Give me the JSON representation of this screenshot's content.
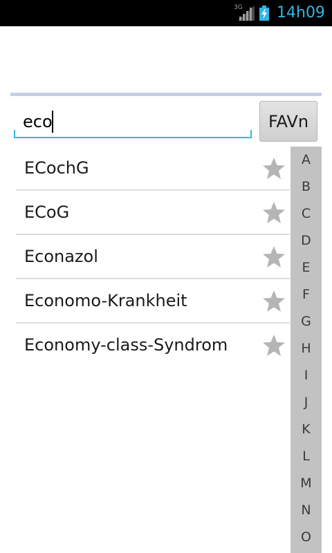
{
  "status_bar": {
    "network_type": "3G",
    "time": "14h09",
    "signal_icon": "signal-icon",
    "battery_icon": "battery-charging-icon",
    "time_color": "#33b5e5"
  },
  "search": {
    "value": "eco",
    "placeholder": ""
  },
  "fav_button": {
    "label": "FAVn"
  },
  "results": [
    {
      "label": "ECochG",
      "icon": "star-icon"
    },
    {
      "label": "ECoG",
      "icon": "star-icon"
    },
    {
      "label": "Econazol",
      "icon": "star-icon"
    },
    {
      "label": "Economo-Krankheit",
      "icon": "star-icon"
    },
    {
      "label": "Economy-class-Syndrom",
      "icon": "star-icon"
    }
  ],
  "alphabet_index": [
    "A",
    "B",
    "C",
    "D",
    "E",
    "F",
    "G",
    "H",
    "I",
    "J",
    "K",
    "L",
    "M",
    "N",
    "O"
  ],
  "colors": {
    "accent": "#33b5e5",
    "divider": "#c5cfe8",
    "index_background": "#c2c2c2",
    "star": "#b5b5b5"
  }
}
